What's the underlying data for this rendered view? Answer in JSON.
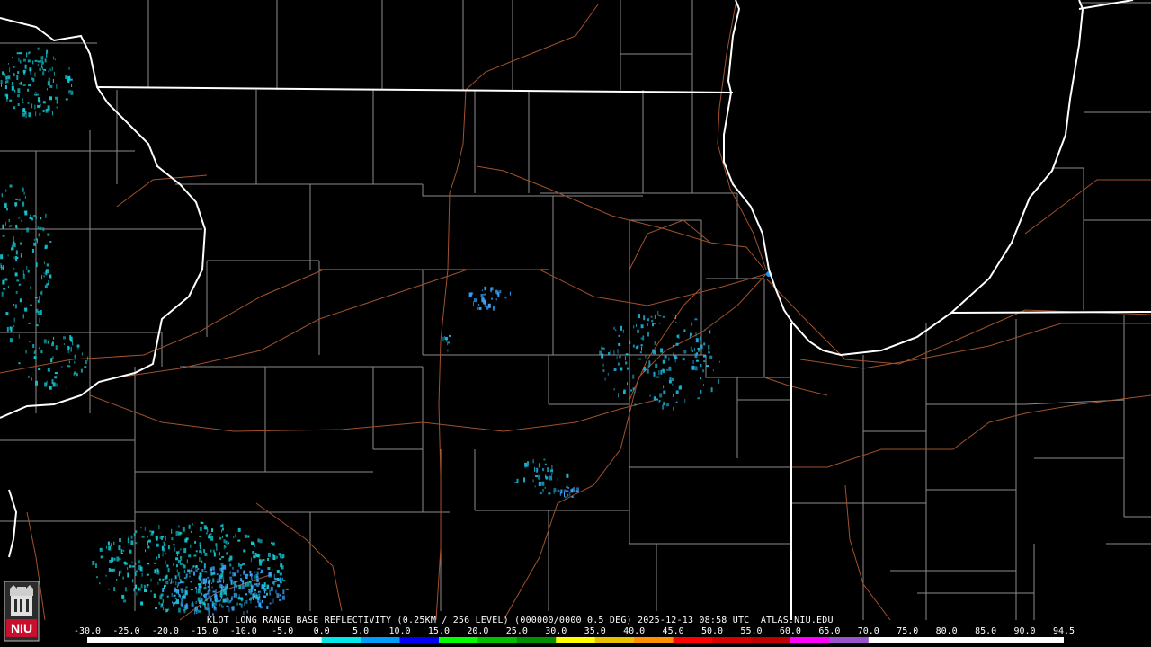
{
  "caption": "KLOT LONG RANGE BASE REFLECTIVITY (0.25KM / 256 LEVEL) (000000/0000 0.5 DEG) 2025-12-13 08:58 UTC  ATLAS.NIU.EDU",
  "logo_text": "NIU",
  "colorscale": {
    "labels": [
      "-30.0",
      "-25.0",
      "-20.0",
      "-15.0",
      "-10.0",
      "-5.0",
      "0.0",
      "5.0",
      "10.0",
      "15.0",
      "20.0",
      "25.0",
      "30.0",
      "35.0",
      "40.0",
      "45.0",
      "50.0",
      "55.0",
      "60.0",
      "65.0",
      "70.0",
      "75.0",
      "80.0",
      "85.0",
      "90.0",
      "94.5"
    ],
    "colors": [
      "#ffffff",
      "#ffffff",
      "#ffffff",
      "#ffffff",
      "#ffffff",
      "#ffffff",
      "#00e8e8",
      "#009ef8",
      "#0000f8",
      "#00ff00",
      "#00c000",
      "#009000",
      "#ffff00",
      "#e7c000",
      "#ff9000",
      "#ff0000",
      "#d60000",
      "#c00000",
      "#ff00ff",
      "#9955c9",
      "#ffffff",
      "#ffffff",
      "#ffffff",
      "#ffffff",
      "#ffffff"
    ]
  },
  "map_colors": {
    "background": "#000000",
    "state_border": "#ffffff",
    "county_line": "#8c8c8c",
    "highway": "#a0522d",
    "echo_light": "#14c8d2",
    "echo_blue": "#1e96ff"
  }
}
